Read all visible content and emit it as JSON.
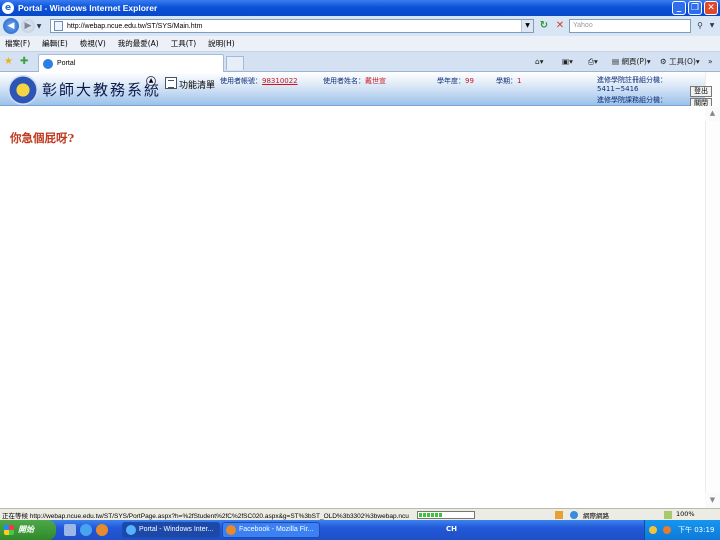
{
  "window": {
    "title": "Portal - Windows Internet Explorer",
    "controls": [
      "_",
      "❐",
      "✕"
    ]
  },
  "address": {
    "url": "http://webap.ncue.edu.tw/ST/SYS/Main.htm",
    "search_placeholder": "Yahoo"
  },
  "menubar": [
    "檔案(F)",
    "編輯(E)",
    "檢視(V)",
    "我的最愛(A)",
    "工具(T)",
    "說明(H)"
  ],
  "tabbar": {
    "tab_title": "Portal",
    "cmd_page": "網頁(P)",
    "cmd_tools": "工具(O)"
  },
  "site": {
    "title": "彰師大教務系統",
    "menu_label": "功能清單",
    "account_label": "使用者帳號：",
    "account_value": "98310022",
    "name_label": "使用者姓名：",
    "name_value": "戴世宣",
    "year_label": "學年度：",
    "year_value": "99",
    "term_label": "學期：",
    "term_value": "1",
    "contact1_label": "進修學院註冊組分機：",
    "contact1_value": "5411~5416",
    "contact2_label": "進修學院課務組分機：",
    "logout": "登出",
    "close": "關閉"
  },
  "content": {
    "message": "你急個屁呀?"
  },
  "status": {
    "text": "正在等候 http://webap.ncue.edu.tw/ST/SYS/PortPage.aspx?h=%2fStudent%2fC%2fSC020.aspx&g=ST%3bST_OLD%3b3302%3bwebap.ncu",
    "progress": 0.45,
    "zone": "網際網路",
    "zoom": "100%"
  },
  "taskbar": {
    "start": "開始",
    "tasks": [
      "Portal - Windows Inter...",
      "Facebook - Mozilla Fir..."
    ],
    "lang": "CH",
    "clock": "下午 03:19"
  }
}
